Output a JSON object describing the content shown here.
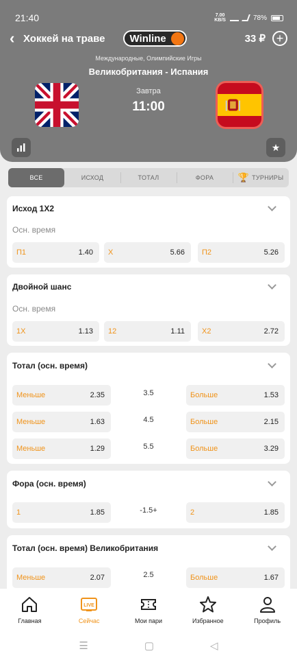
{
  "status": {
    "time": "21:40",
    "net_speed": "7.00",
    "net_unit": "KB/S",
    "battery": "78%"
  },
  "header": {
    "sport": "Хоккей на траве",
    "logo": "Winline",
    "balance": "33 ₽",
    "league": "Международные, Олимпийские Игры",
    "match": "Великобритания - Испания",
    "day": "Завтра",
    "time": "11:00"
  },
  "tabs": [
    "ВСЕ",
    "ИСХОД",
    "ТОТАЛ",
    "ФОРА",
    "ТУРНИРЫ"
  ],
  "markets": {
    "m1x2": {
      "title": "Исход 1X2",
      "period": "Осн. время",
      "odds": [
        {
          "label": "П1",
          "value": "1.40"
        },
        {
          "label": "Х",
          "value": "5.66"
        },
        {
          "label": "П2",
          "value": "5.26"
        }
      ]
    },
    "double": {
      "title": "Двойной шанс",
      "period": "Осн. время",
      "odds": [
        {
          "label": "1X",
          "value": "1.13"
        },
        {
          "label": "12",
          "value": "1.11"
        },
        {
          "label": "X2",
          "value": "2.72"
        }
      ]
    },
    "total": {
      "title": "Тотал (осн. время)",
      "rows": [
        {
          "under_label": "Меньше",
          "under": "2.35",
          "line": "3.5",
          "over_label": "Больше",
          "over": "1.53"
        },
        {
          "under_label": "Меньше",
          "under": "1.63",
          "line": "4.5",
          "over_label": "Больше",
          "over": "2.15"
        },
        {
          "under_label": "Меньше",
          "under": "1.29",
          "line": "5.5",
          "over_label": "Больше",
          "over": "3.29"
        }
      ]
    },
    "handicap": {
      "title": "Фора (осн. время)",
      "row": {
        "left_label": "1",
        "left": "1.85",
        "line": "-1.5+",
        "right_label": "2",
        "right": "1.85"
      }
    },
    "team_total": {
      "title": "Тотал (осн. время)  Великобритания",
      "row": {
        "under_label": "Меньше",
        "under": "2.07",
        "line": "2.5",
        "over_label": "Больше",
        "over": "1.67"
      }
    }
  },
  "bottom_nav": [
    {
      "label": "Главная",
      "icon": "home-icon"
    },
    {
      "label": "Сейчас",
      "icon": "live-icon",
      "badge": "LIVE"
    },
    {
      "label": "Мои пари",
      "icon": "ticket-icon"
    },
    {
      "label": "Избранное",
      "icon": "star-icon"
    },
    {
      "label": "Профиль",
      "icon": "profile-icon"
    }
  ],
  "colors": {
    "accent": "#f0931a",
    "header_bg": "#7b7b7b",
    "logo_dot": "#f27613"
  }
}
